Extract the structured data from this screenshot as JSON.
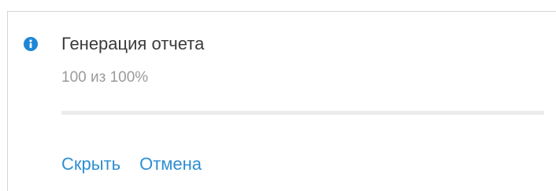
{
  "notification": {
    "icon": "info-icon",
    "title": "Генерация отчета",
    "progress_text": "100 из 100%",
    "progress": 1.0
  },
  "actions": {
    "hide_label": "Скрыть",
    "cancel_label": "Отмена"
  },
  "colors": {
    "accent": "#2e8fd3",
    "info_icon": "#1f88d6",
    "title_text": "#3b3b3b",
    "muted_text": "#9a9a9a",
    "track": "#ececec"
  }
}
